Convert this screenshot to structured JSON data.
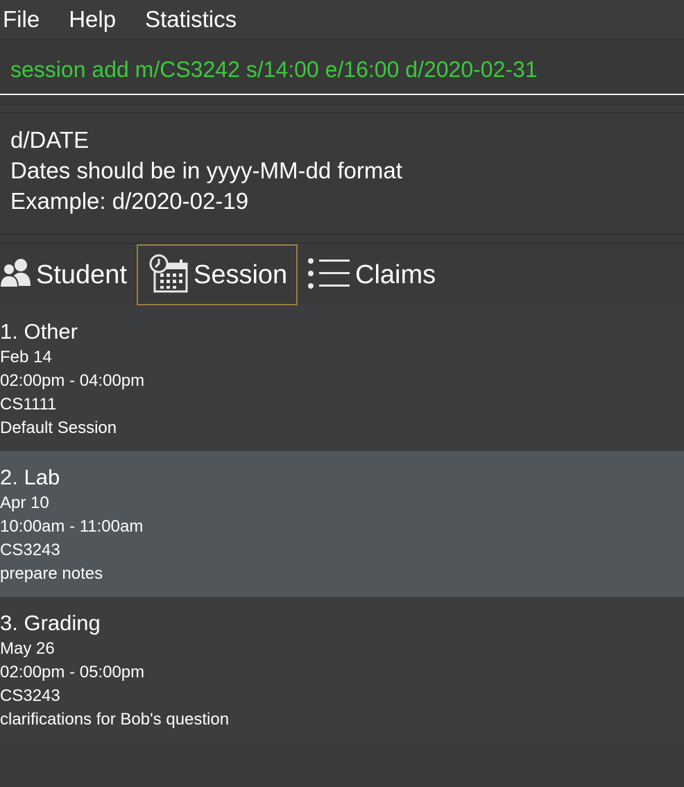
{
  "menu": {
    "items": [
      "File",
      "Help",
      "Statistics"
    ]
  },
  "command": {
    "value": "session add m/CS3242 s/14:00 e/16:00 d/2020-02-31"
  },
  "result": {
    "lines": [
      "d/DATE",
      "Dates should be in yyyy-MM-dd format",
      "Example: d/2020-02-19"
    ]
  },
  "tabs": [
    {
      "label": "Student",
      "icon": "students-icon"
    },
    {
      "label": "Session",
      "icon": "session-calendar-icon",
      "selected": true
    },
    {
      "label": "Claims",
      "icon": "list-icon"
    }
  ],
  "sessions": [
    {
      "title": "1.  Other",
      "date": "Feb 14",
      "time": "02:00pm - 04:00pm",
      "module": "CS1111",
      "description": "Default Session"
    },
    {
      "title": "2.  Lab",
      "date": "Apr 10",
      "time": "10:00am - 11:00am",
      "module": "CS3243",
      "description": "prepare notes",
      "selected": true
    },
    {
      "title": "3.  Grading",
      "date": "May 26",
      "time": "02:00pm - 05:00pm",
      "module": "CS3243",
      "description": "clarifications for Bob's question"
    }
  ],
  "colors": {
    "command_text": "#3cc93c",
    "selected_tab_border": "#9a7f42",
    "selected_card_bg": "#505659",
    "card_bg": "#3c3d3f"
  }
}
